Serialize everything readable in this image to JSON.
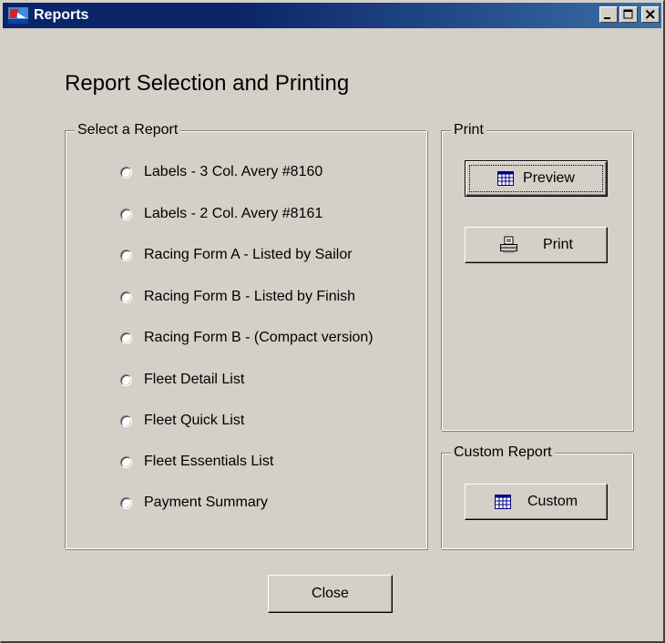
{
  "window": {
    "title": "Reports",
    "heading": "Report Selection and Printing"
  },
  "select_report": {
    "legend": "Select a Report",
    "options": [
      {
        "label": "Labels - 3 Col. Avery #8160",
        "selected": false
      },
      {
        "label": "Labels - 2 Col. Avery #8161",
        "selected": false
      },
      {
        "label": "Racing Form A - Listed by Sailor",
        "selected": false
      },
      {
        "label": "Racing Form B - Listed by Finish",
        "selected": false
      },
      {
        "label": "Racing Form B  - (Compact version)",
        "selected": false
      },
      {
        "label": "Fleet Detail List",
        "selected": false
      },
      {
        "label": "Fleet Quick List",
        "selected": false
      },
      {
        "label": "Fleet Essentials List",
        "selected": false
      },
      {
        "label": "Payment Summary",
        "selected": false
      }
    ]
  },
  "print": {
    "legend": "Print",
    "preview_label": "Preview",
    "print_label": "Print"
  },
  "custom": {
    "legend": "Custom Report",
    "custom_label": "Custom"
  },
  "close_label": "Close",
  "colors": {
    "window_bg": "#d4d0c8",
    "titlebar_start": "#0a246a",
    "titlebar_end": "#3a6ea5"
  },
  "icons": [
    "app-icon",
    "minimize-icon",
    "maximize-icon",
    "close-icon",
    "preview-grid-icon",
    "printer-icon",
    "custom-grid-icon"
  ]
}
